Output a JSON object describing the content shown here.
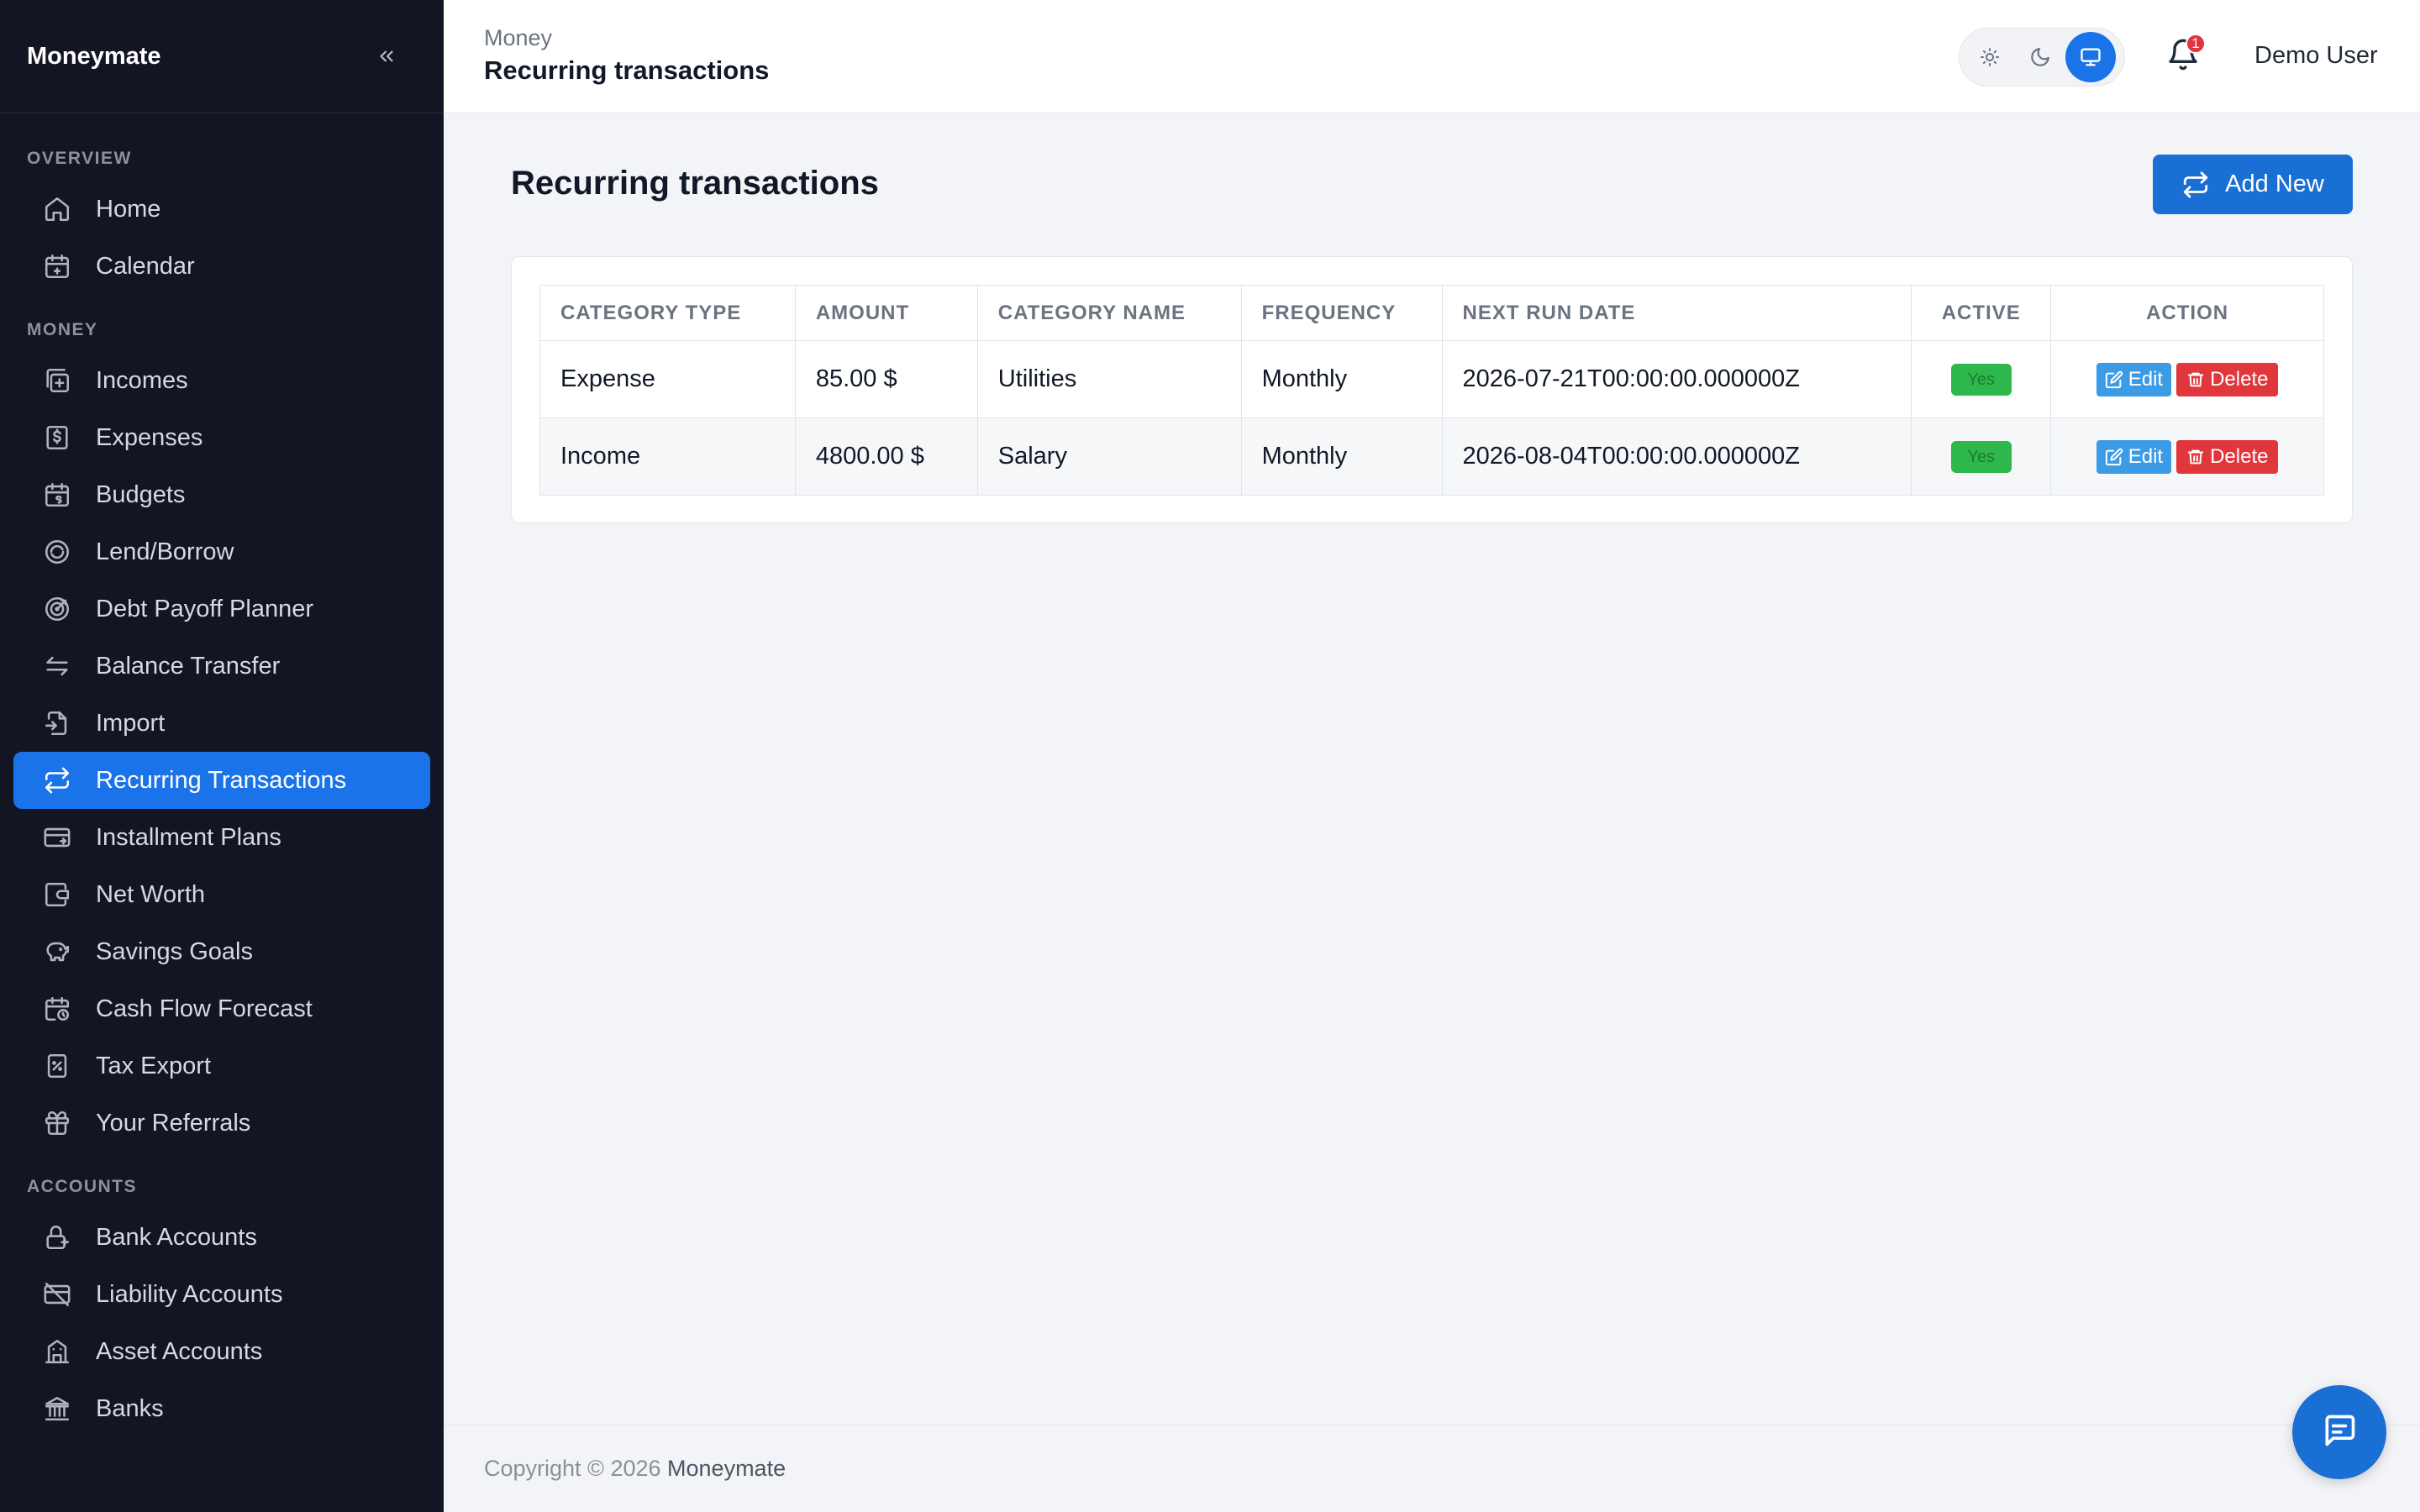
{
  "app": {
    "name": "Moneymate"
  },
  "sidebar": {
    "sections": [
      {
        "label": "OVERVIEW",
        "items": [
          {
            "label": "Home",
            "icon": "home-icon"
          },
          {
            "label": "Calendar",
            "icon": "calendar-icon"
          }
        ]
      },
      {
        "label": "MONEY",
        "items": [
          {
            "label": "Incomes",
            "icon": "incomes-icon"
          },
          {
            "label": "Expenses",
            "icon": "expenses-icon"
          },
          {
            "label": "Budgets",
            "icon": "budgets-icon"
          },
          {
            "label": "Lend/Borrow",
            "icon": "lend-borrow-icon"
          },
          {
            "label": "Debt Payoff Planner",
            "icon": "target-icon"
          },
          {
            "label": "Balance Transfer",
            "icon": "transfer-icon"
          },
          {
            "label": "Import",
            "icon": "import-icon"
          },
          {
            "label": "Recurring Transactions",
            "icon": "repeat-icon",
            "active": true
          },
          {
            "label": "Installment Plans",
            "icon": "installment-icon"
          },
          {
            "label": "Net Worth",
            "icon": "wallet-icon"
          },
          {
            "label": "Savings Goals",
            "icon": "piggy-bank-icon"
          },
          {
            "label": "Cash Flow Forecast",
            "icon": "calendar-clock-icon"
          },
          {
            "label": "Tax Export",
            "icon": "tax-icon"
          },
          {
            "label": "Your Referrals",
            "icon": "gift-icon"
          }
        ]
      },
      {
        "label": "ACCOUNTS",
        "items": [
          {
            "label": "Bank Accounts",
            "icon": "bank-lock-icon"
          },
          {
            "label": "Liability Accounts",
            "icon": "card-off-icon"
          },
          {
            "label": "Asset Accounts",
            "icon": "building-icon"
          },
          {
            "label": "Banks",
            "icon": "bank-icon"
          }
        ]
      }
    ]
  },
  "header": {
    "breadcrumb": "Money",
    "title": "Recurring transactions",
    "theme_modes": [
      "light",
      "dark",
      "system"
    ],
    "theme_selected": "system",
    "notification_count": "1",
    "user_name": "Demo User"
  },
  "main": {
    "title": "Recurring transactions",
    "add_button": "Add New",
    "table": {
      "columns": [
        "CATEGORY TYPE",
        "AMOUNT",
        "CATEGORY NAME",
        "FREQUENCY",
        "NEXT RUN DATE",
        "ACTIVE",
        "ACTION"
      ],
      "rows": [
        {
          "category_type": "Expense",
          "amount": "85.00 $",
          "category_name": "Utilities",
          "frequency": "Monthly",
          "next_run_date": "2026-07-21T00:00:00.000000Z",
          "active": "Yes"
        },
        {
          "category_type": "Income",
          "amount": "4800.00 $",
          "category_name": "Salary",
          "frequency": "Monthly",
          "next_run_date": "2026-08-04T00:00:00.000000Z",
          "active": "Yes"
        }
      ],
      "edit_label": "Edit",
      "delete_label": "Delete"
    }
  },
  "footer": {
    "copyright": "Copyright © 2026",
    "brand": "Moneymate"
  },
  "colors": {
    "accent": "#1a73e8",
    "sidebar_bg": "#131622",
    "success": "#2eb84b",
    "danger": "#e0363c",
    "info": "#3b9be4"
  }
}
